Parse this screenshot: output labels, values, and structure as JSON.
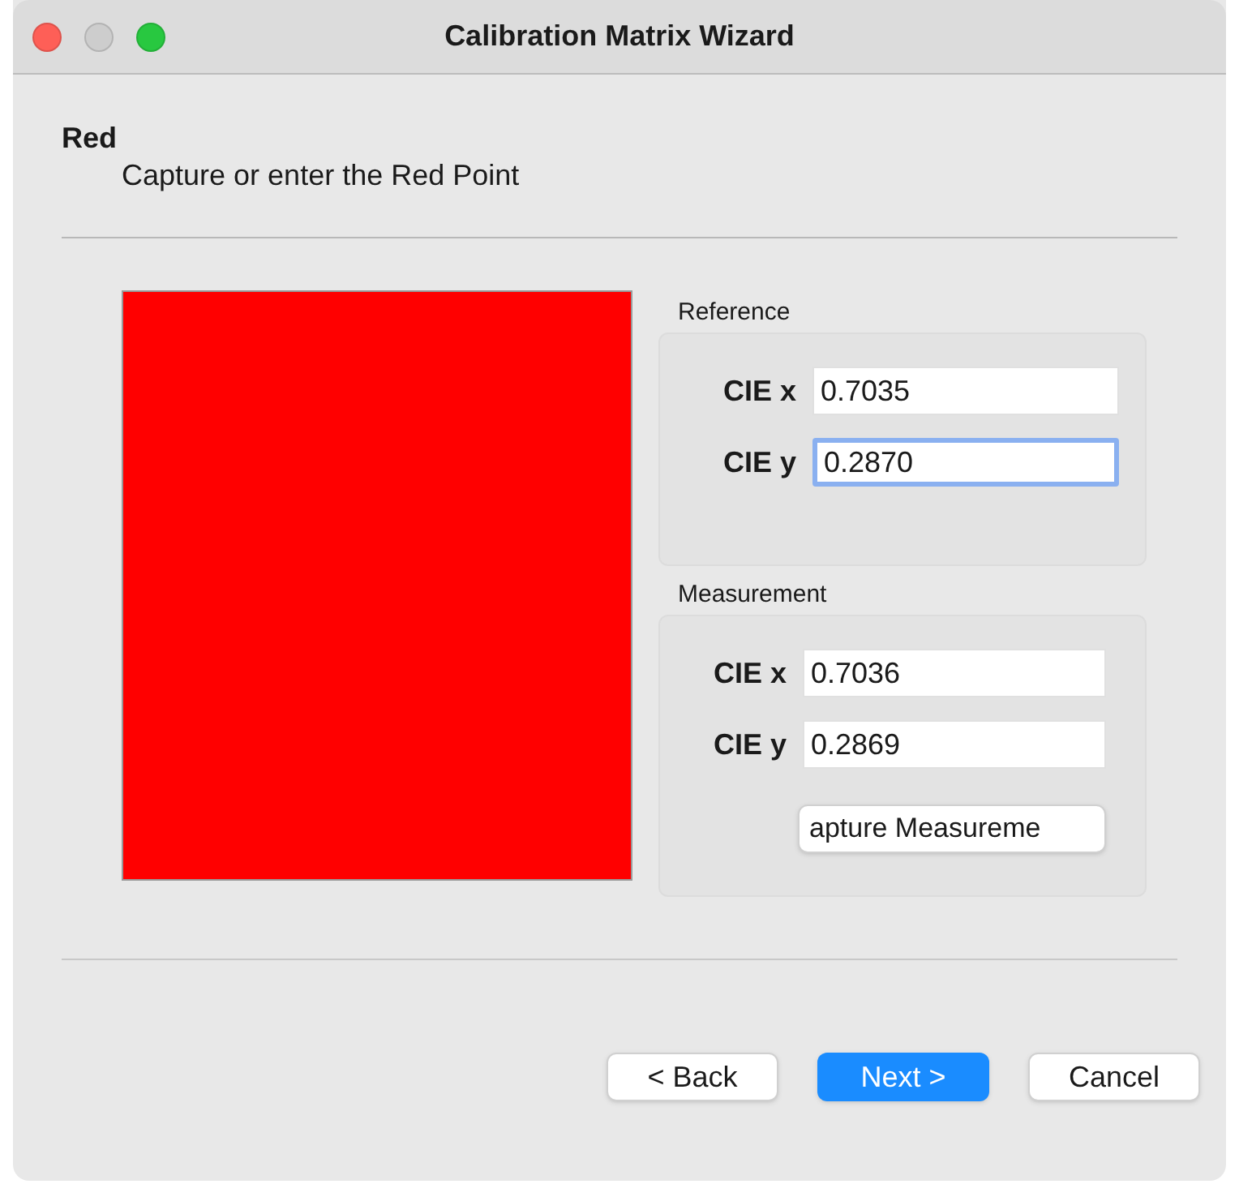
{
  "window": {
    "title": "Calibration Matrix Wizard",
    "controls": [
      {
        "kind": "close",
        "active": true
      },
      {
        "kind": "minimize",
        "active": false
      },
      {
        "kind": "zoom",
        "active": true
      }
    ]
  },
  "page": {
    "heading": "Red",
    "subtitle": "Capture or enter the Red Point"
  },
  "swatch": {
    "color": "#ff0000"
  },
  "groups": [
    {
      "title": "Reference",
      "fields": [
        {
          "label": "CIE x",
          "value": "0.7035",
          "focused": false
        },
        {
          "label": "CIE y",
          "value": "0.2870",
          "focused": true
        }
      ]
    },
    {
      "title": "Measurement",
      "fields": [
        {
          "label": "CIE x",
          "value": "0.7036",
          "focused": false
        },
        {
          "label": "CIE y",
          "value": "0.2869",
          "focused": false
        }
      ],
      "button": "apture Measureme"
    }
  ],
  "buttons": [
    {
      "label": "< Back",
      "kind": "default"
    },
    {
      "label": "Next >",
      "kind": "primary"
    },
    {
      "label": "Cancel",
      "kind": "default"
    }
  ]
}
